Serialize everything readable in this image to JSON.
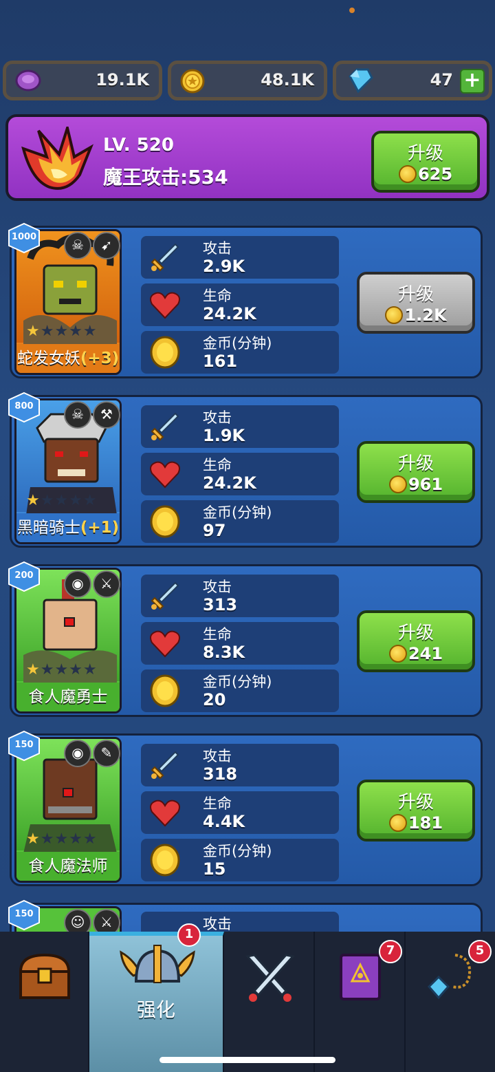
{
  "currencies": [
    {
      "icon": "purple-gem-icon",
      "value": "19.1K"
    },
    {
      "icon": "gold-coin-icon",
      "value": "48.1K"
    },
    {
      "icon": "diamond-icon",
      "value": "47",
      "add_label": "+"
    }
  ],
  "boss": {
    "level": "LV. 520",
    "attack": "魔王攻击:534",
    "upgrade_label": "升级",
    "upgrade_cost": "625"
  },
  "heroes": [
    {
      "badge": "1000",
      "name": "蛇发女妖",
      "plus": "(+3)",
      "stars": 1,
      "attack_label": "攻击",
      "attack": "2.9K",
      "hp_label": "生命",
      "hp": "24.2K",
      "gold_label": "金币(分钟)",
      "gold": "161",
      "upgrade_label": "升级",
      "upgrade_cost": "1.2K",
      "upgrade_enabled": false
    },
    {
      "badge": "800",
      "name": "黑暗骑士",
      "plus": "(+1)",
      "stars": 1,
      "attack_label": "攻击",
      "attack": "1.9K",
      "hp_label": "生命",
      "hp": "24.2K",
      "gold_label": "金币(分钟)",
      "gold": "97",
      "upgrade_label": "升级",
      "upgrade_cost": "961",
      "upgrade_enabled": true
    },
    {
      "badge": "200",
      "name": "食人魔勇士",
      "plus": "",
      "stars": 1,
      "attack_label": "攻击",
      "attack": "313",
      "hp_label": "生命",
      "hp": "8.3K",
      "gold_label": "金币(分钟)",
      "gold": "20",
      "upgrade_label": "升级",
      "upgrade_cost": "241",
      "upgrade_enabled": true
    },
    {
      "badge": "150",
      "name": "食人魔法师",
      "plus": "",
      "stars": 1,
      "attack_label": "攻击",
      "attack": "318",
      "hp_label": "生命",
      "hp": "4.4K",
      "gold_label": "金币(分钟)",
      "gold": "15",
      "upgrade_label": "升级",
      "upgrade_cost": "181",
      "upgrade_enabled": true
    },
    {
      "badge": "150",
      "attack_label": "攻击"
    }
  ],
  "nav": {
    "tabs": [
      {
        "icon": "treasure-chest-icon",
        "label": ""
      },
      {
        "icon": "winged-helmet-icon",
        "label": "强化",
        "badge": "1"
      },
      {
        "icon": "crossed-swords-icon",
        "label": ""
      },
      {
        "icon": "spellbook-icon",
        "label": "",
        "badge": "7"
      },
      {
        "icon": "amulet-icon",
        "label": "",
        "badge": "5"
      }
    ]
  }
}
